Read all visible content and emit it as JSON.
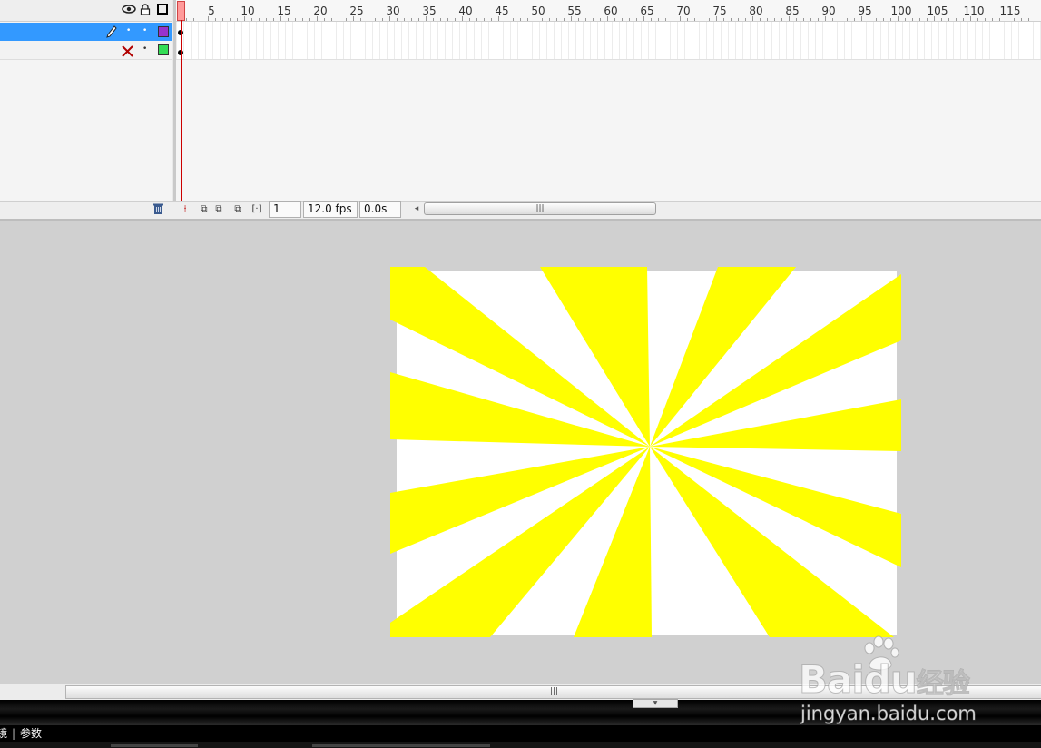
{
  "timeline": {
    "ruler_labels": [
      "5",
      "10",
      "15",
      "20",
      "25",
      "30",
      "35",
      "40",
      "45",
      "50",
      "55",
      "60",
      "65",
      "70",
      "75",
      "80",
      "85",
      "90",
      "95",
      "100",
      "105",
      "110",
      "115"
    ],
    "current_frame": "1",
    "frame_rate": "12.0 fps",
    "elapsed_time": "0.0s",
    "layers": [
      {
        "color": "#9933cc",
        "selected": true,
        "status_icon": "pencil-icon"
      },
      {
        "color": "#33cc33",
        "selected": false,
        "status_icon": "red-x-icon"
      }
    ]
  },
  "stage": {
    "background_color": "#ffffff",
    "ray_color": "#ffff00",
    "pasteboard_color": "#d0d0d0"
  },
  "properties_panel": {
    "tab_truncated": "镜",
    "tab_parameters": "参数"
  },
  "watermark": {
    "logo_text": "Bai",
    "logo_text_2": "du",
    "logo_cn": "经验",
    "url": "jingyan.baidu.com"
  }
}
